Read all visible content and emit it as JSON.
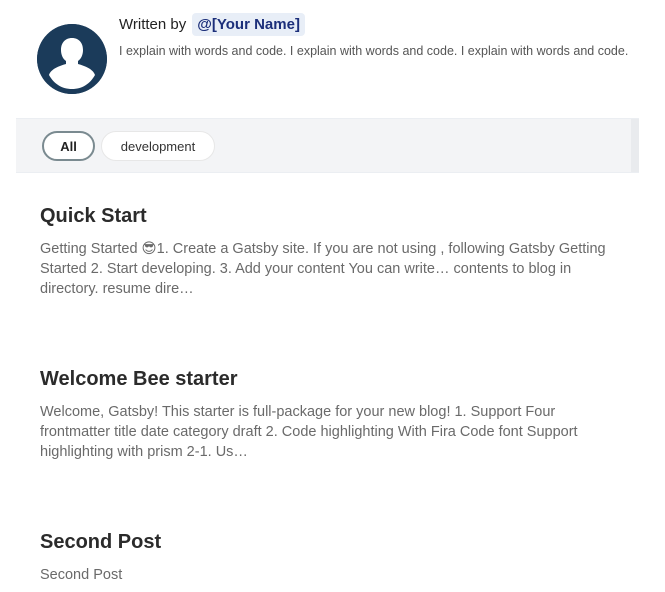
{
  "bio": {
    "written_by": "Written by",
    "author": "@[Your Name]",
    "description": "I explain with words and code. I explain with words and code. I explain with words and code.",
    "avatar_color": "#1b3b5a"
  },
  "categories": {
    "items": [
      {
        "label": "All",
        "active": true
      },
      {
        "label": "development",
        "active": false
      }
    ]
  },
  "posts": [
    {
      "title": "Quick Start",
      "excerpt": "Getting Started 😎1. Create a Gatsby site. If you are not using , following Gatsby Getting Started 2. Start developing. 3. Add your content You can write… contents to blog in directory. resume dire…"
    },
    {
      "title": "Welcome Bee starter",
      "excerpt": "Welcome, Gatsby! This starter is full-package for your new blog! 1. Support Four frontmatter title date category draft 2. Code highlighting With Fira Code font Support highlighting with prism 2-1. Us…"
    },
    {
      "title": "Second Post",
      "excerpt": "Second Post"
    }
  ]
}
